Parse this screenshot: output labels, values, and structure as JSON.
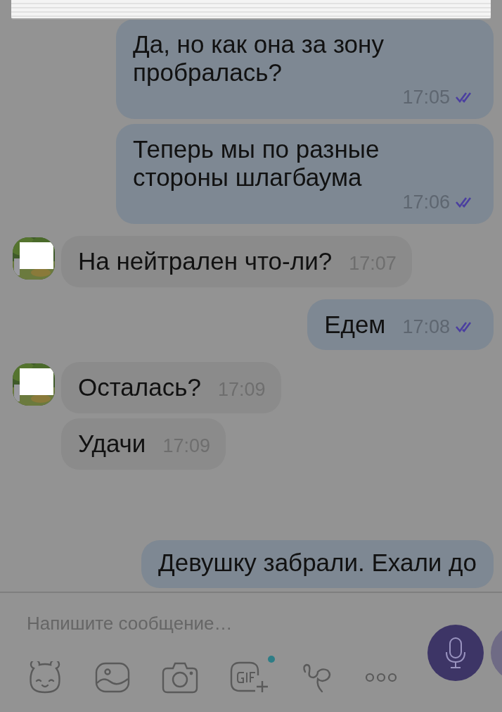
{
  "messages": [
    {
      "kind": "outgoing",
      "text": "Да, но как она за зону пробралась?",
      "time": "17:05",
      "read": true
    },
    {
      "kind": "outgoing",
      "text": "Теперь мы по разные стороны шлагбаума",
      "time": "17:06",
      "read": true
    },
    {
      "kind": "incoming",
      "avatar": true,
      "text": "На нейтрален что-ли?",
      "time": "17:07"
    },
    {
      "kind": "outgoing",
      "text": "Едем",
      "time": "17:08",
      "read": true
    },
    {
      "kind": "incoming",
      "avatar": true,
      "text": "Осталась?",
      "time": "17:09"
    },
    {
      "kind": "incoming",
      "avatar": false,
      "text": "Удачи",
      "time": "17:09"
    },
    {
      "kind": "outgoing",
      "text": "Девушку забрали. Ехали до"
    }
  ],
  "composer": {
    "placeholder": "Напишите сообщение…",
    "gif_badge": true
  }
}
